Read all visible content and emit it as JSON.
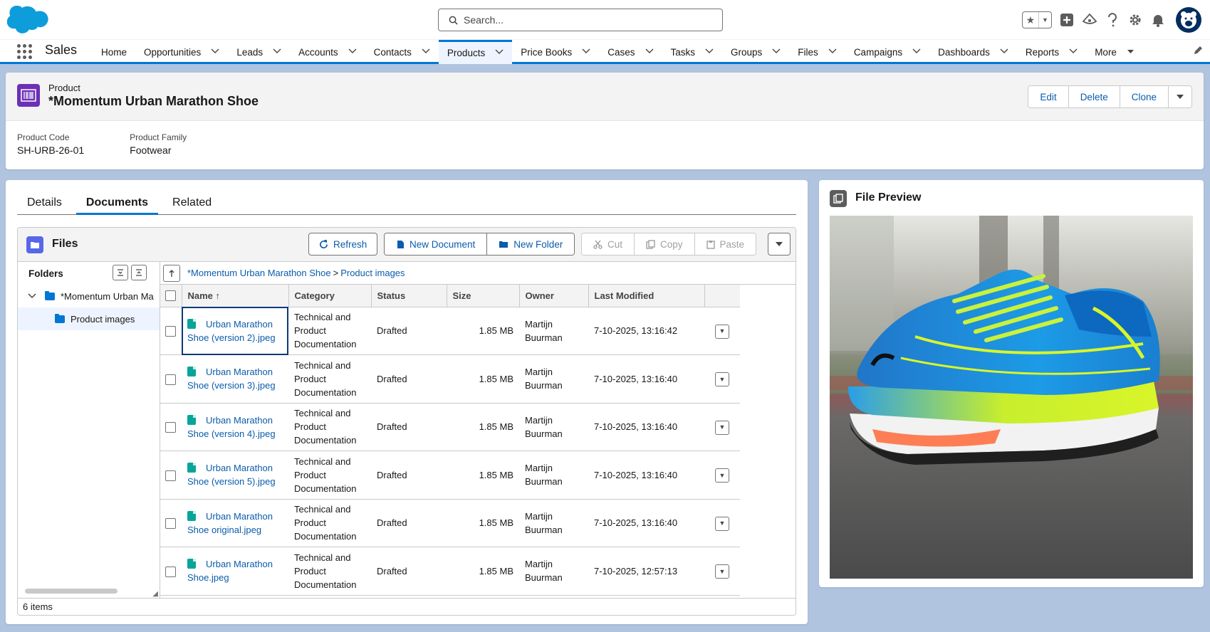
{
  "header": {
    "search_placeholder": "Search..."
  },
  "nav": {
    "app_name": "Sales",
    "items": [
      {
        "label": "Home",
        "has_menu": false
      },
      {
        "label": "Opportunities",
        "has_menu": true
      },
      {
        "label": "Leads",
        "has_menu": true
      },
      {
        "label": "Accounts",
        "has_menu": true
      },
      {
        "label": "Contacts",
        "has_menu": true
      },
      {
        "label": "Products",
        "has_menu": true,
        "active": true
      },
      {
        "label": "Price Books",
        "has_menu": true
      },
      {
        "label": "Cases",
        "has_menu": true
      },
      {
        "label": "Tasks",
        "has_menu": true
      },
      {
        "label": "Groups",
        "has_menu": true
      },
      {
        "label": "Files",
        "has_menu": true
      },
      {
        "label": "Campaigns",
        "has_menu": true
      },
      {
        "label": "Dashboards",
        "has_menu": true
      },
      {
        "label": "Reports",
        "has_menu": true
      },
      {
        "label": "More",
        "has_menu": true
      }
    ]
  },
  "record": {
    "object_type": "Product",
    "title": "*Momentum Urban Marathon Shoe",
    "actions": [
      "Edit",
      "Delete",
      "Clone"
    ],
    "fields": [
      {
        "label": "Product Code",
        "value": "SH-URB-26-01"
      },
      {
        "label": "Product Family",
        "value": "Footwear"
      }
    ]
  },
  "tabs": [
    {
      "label": "Details",
      "active": false
    },
    {
      "label": "Documents",
      "active": true
    },
    {
      "label": "Related",
      "active": false
    }
  ],
  "files": {
    "title": "Files",
    "toolbar": {
      "refresh": "Refresh",
      "new_document": "New Document",
      "new_folder": "New Folder",
      "cut": "Cut",
      "copy": "Copy",
      "paste": "Paste"
    },
    "folders_label": "Folders",
    "tree": [
      {
        "label": "*Momentum Urban Ma",
        "level": 0,
        "expanded": true,
        "selected": false
      },
      {
        "label": "Product images",
        "level": 1,
        "selected": true
      }
    ],
    "breadcrumb": [
      "*Momentum Urban Marathon Shoe",
      "Product images"
    ],
    "breadcrumb_sep": ">",
    "columns": [
      "Name",
      "Category",
      "Status",
      "Size",
      "Owner",
      "Last Modified"
    ],
    "sort_indicator": "↑",
    "rows": [
      {
        "name": "Urban Marathon Shoe (version 2).jpeg",
        "category": "Technical and Product Documentation",
        "status": "Drafted",
        "size": "1.85 MB",
        "owner": "Martijn Buurman",
        "modified": "7-10-2025, 13:16:42"
      },
      {
        "name": "Urban Marathon Shoe (version 3).jpeg",
        "category": "Technical and Product Documentation",
        "status": "Drafted",
        "size": "1.85 MB",
        "owner": "Martijn Buurman",
        "modified": "7-10-2025, 13:16:40"
      },
      {
        "name": "Urban Marathon Shoe (version 4).jpeg",
        "category": "Technical and Product Documentation",
        "status": "Drafted",
        "size": "1.85 MB",
        "owner": "Martijn Buurman",
        "modified": "7-10-2025, 13:16:40"
      },
      {
        "name": "Urban Marathon Shoe (version 5).jpeg",
        "category": "Technical and Product Documentation",
        "status": "Drafted",
        "size": "1.85 MB",
        "owner": "Martijn Buurman",
        "modified": "7-10-2025, 13:16:40"
      },
      {
        "name": "Urban Marathon Shoe original.jpeg",
        "category": "Technical and Product Documentation",
        "status": "Drafted",
        "size": "1.85 MB",
        "owner": "Martijn Buurman",
        "modified": "7-10-2025, 13:16:40"
      },
      {
        "name": "Urban Marathon Shoe.jpeg",
        "category": "Technical and Product Documentation",
        "status": "Drafted",
        "size": "1.85 MB",
        "owner": "Martijn Buurman",
        "modified": "7-10-2025, 12:57:13"
      }
    ],
    "footer": "6 items"
  },
  "preview": {
    "title": "File Preview"
  },
  "colors": {
    "brand": "#0176d3",
    "link": "#0b5cab",
    "product_icon": "#6b2fb8",
    "files_icon": "#5867e8",
    "image_file_icon": "#06a59a",
    "shoe": "#1e8fe0",
    "shoe_accent": "#d7f22a"
  },
  "icons": {
    "header": [
      "favorites-star-icon",
      "global-add-icon",
      "trailhead-icon",
      "help-icon",
      "setup-gear-icon",
      "notifications-bell-icon",
      "user-avatar"
    ],
    "record": "product-barcode-icon",
    "files": "folder-icon",
    "preview": "file-preview-icon"
  }
}
